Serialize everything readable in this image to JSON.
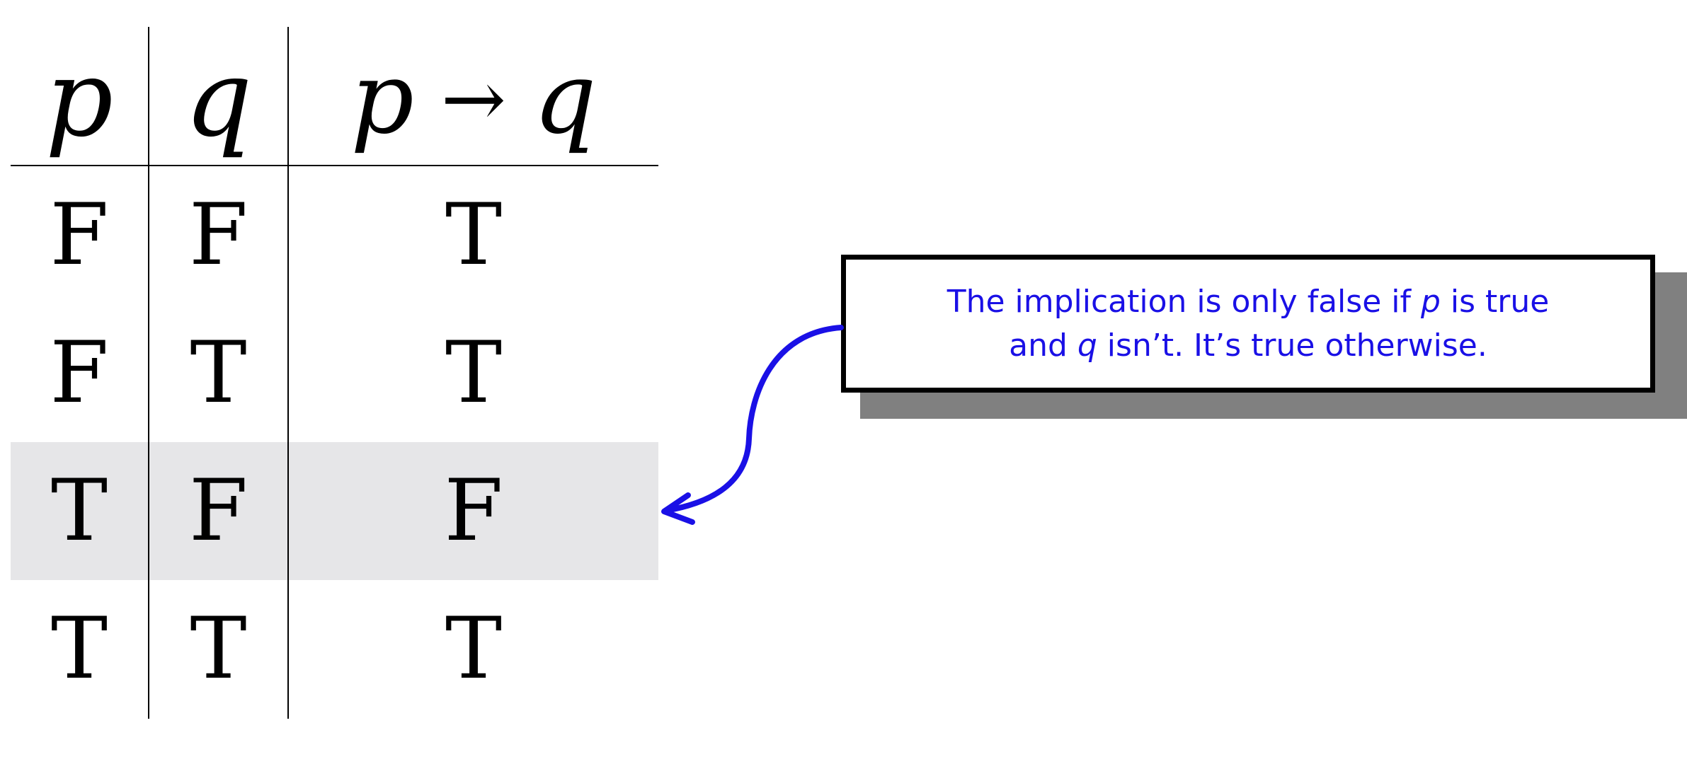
{
  "truth_table": {
    "headers": {
      "p": "p",
      "q": "q",
      "implication_left": "p",
      "implication_arrow": "→",
      "implication_right": "q"
    },
    "rows": [
      {
        "p": "F",
        "q": "F",
        "result": "T"
      },
      {
        "p": "F",
        "q": "T",
        "result": "T"
      },
      {
        "p": "T",
        "q": "F",
        "result": "F"
      },
      {
        "p": "T",
        "q": "T",
        "result": "T"
      }
    ],
    "highlighted_row": 3,
    "highlight_color": "#e6e6e8"
  },
  "callout": {
    "line1_pre": "The implication is only false if ",
    "line1_var": "p",
    "line1_post": " is true",
    "line2_pre": "and ",
    "line2_var": "q",
    "line2_post": " isn’t. It’s true otherwise.",
    "text_color": "#1a10e6",
    "arrow_color": "#1a10e6"
  }
}
